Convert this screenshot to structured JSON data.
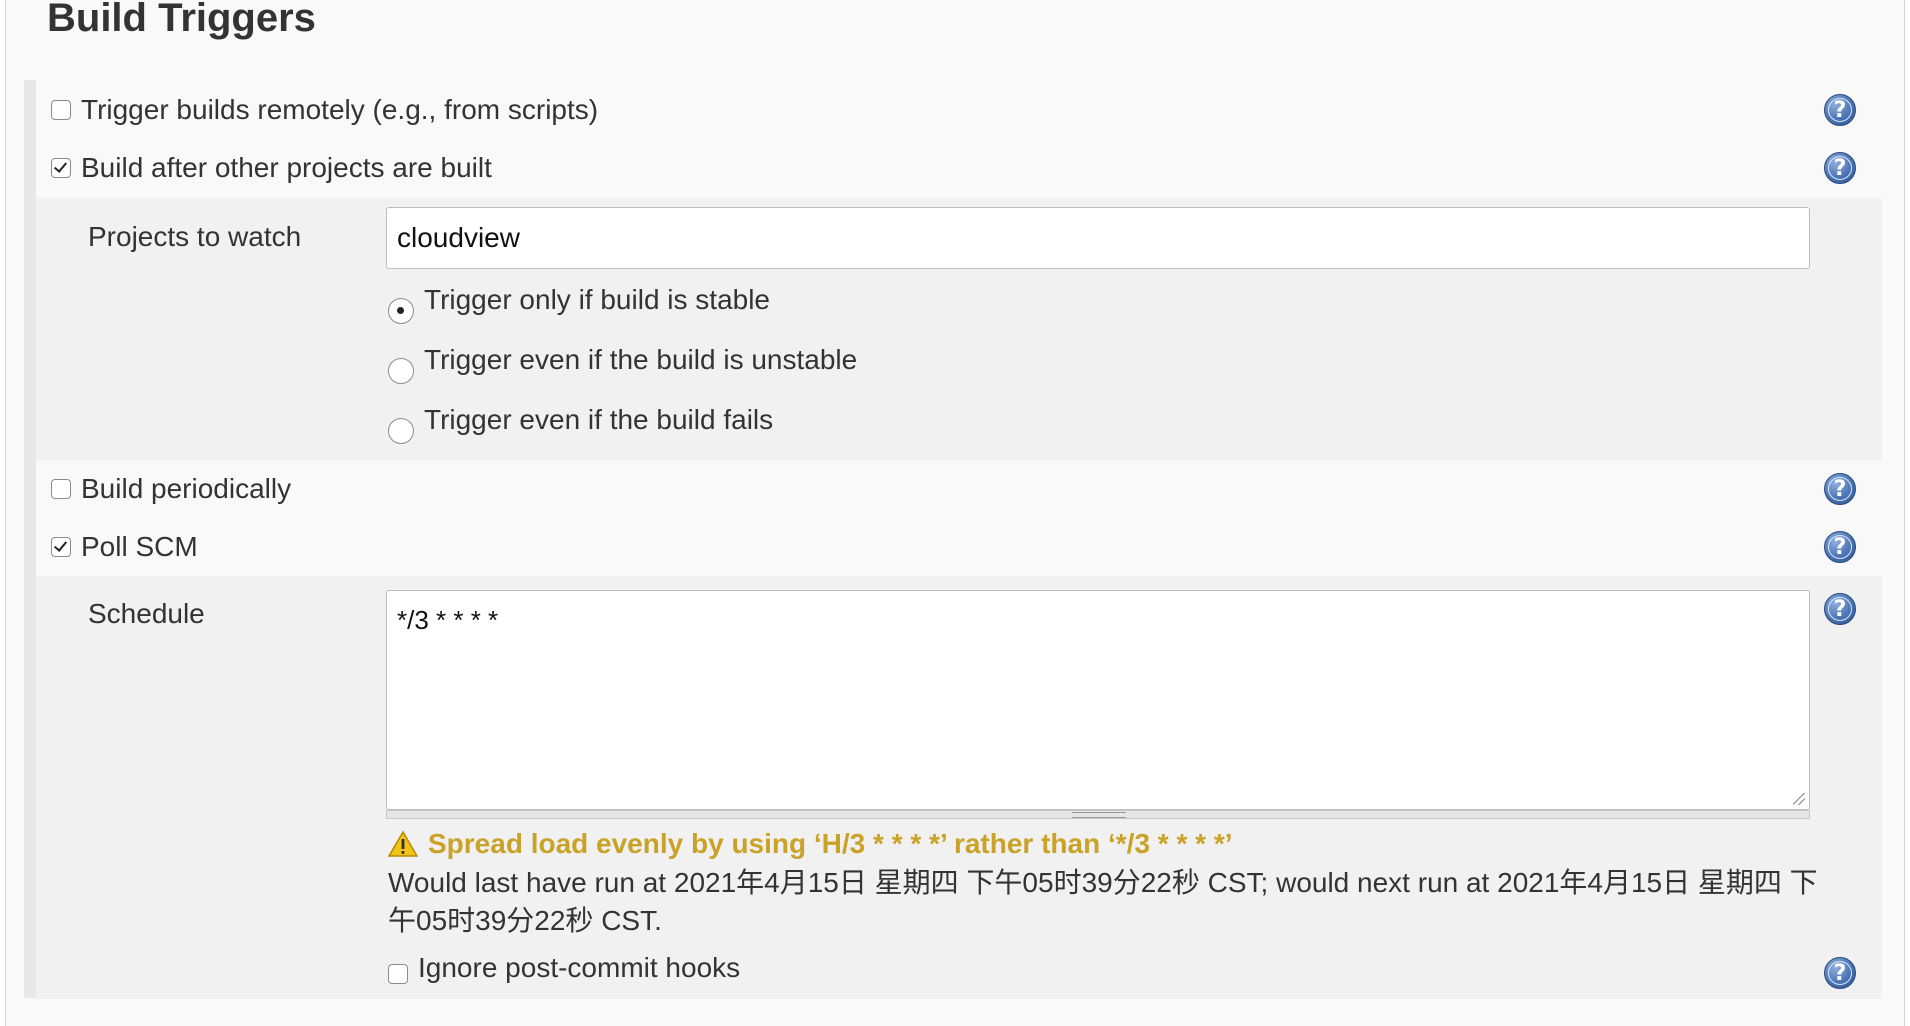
{
  "section": {
    "title": "Build Triggers"
  },
  "triggers": {
    "remote": {
      "label": "Trigger builds remotely (e.g., from scripts)",
      "checked": false
    },
    "after_other": {
      "label": "Build after other projects are built",
      "checked": true
    },
    "periodic": {
      "label": "Build periodically",
      "checked": false
    },
    "poll_scm": {
      "label": "Poll SCM",
      "checked": true
    }
  },
  "after_other_config": {
    "projects_label": "Projects to watch",
    "projects_value": "cloudview",
    "radio_options": [
      {
        "label": "Trigger only if build is stable",
        "selected": true
      },
      {
        "label": "Trigger even if the build is unstable",
        "selected": false
      },
      {
        "label": "Trigger even if the build fails",
        "selected": false
      }
    ]
  },
  "poll_scm_config": {
    "schedule_label": "Schedule",
    "schedule_value": "*/3 * * * *",
    "warning": "Spread load evenly by using ‘H/3 * * * *’ rather than ‘*/3 * * * *’",
    "info": "Would last have run at 2021年4月15日 星期四 下午05时39分22秒 CST; would next run at 2021年4月15日 星期四 下午05时39分22秒 CST.",
    "ignore_hooks_label": "Ignore post-commit hooks",
    "ignore_hooks_checked": false
  },
  "help_icon_glyph": "?",
  "colors": {
    "warning": "#c9a227",
    "help_icon": "#4a74b4"
  }
}
